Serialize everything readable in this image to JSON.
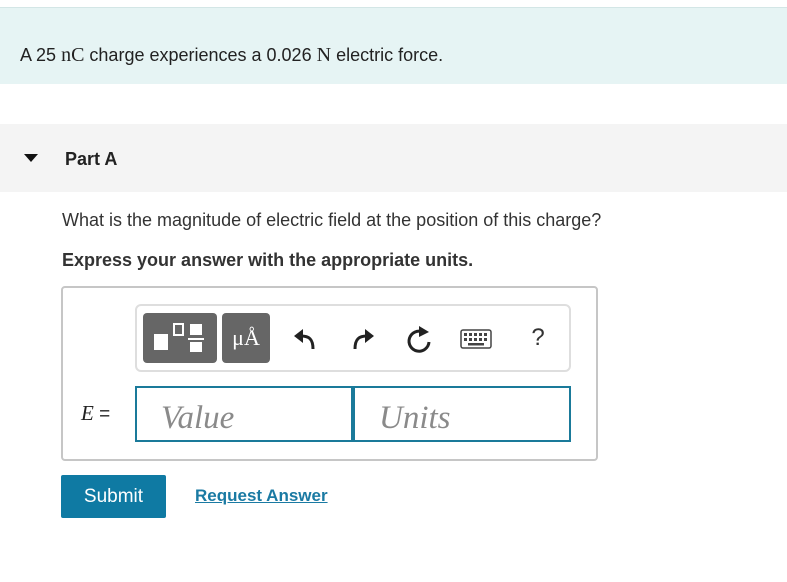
{
  "problem": {
    "text_1": "A 25",
    "charge_unit": "nC",
    "text_2": "charge experiences a 0.026",
    "force_unit": "N",
    "text_3": "electric force."
  },
  "part": {
    "title": "Part A",
    "question": "What is the magnitude of electric field at the position of this charge?",
    "instruction": "Express your answer with the appropriate units."
  },
  "toolbar": {
    "units_label": "μÅ",
    "help_label": "?",
    "icons": [
      "templates-icon",
      "units-icon",
      "undo-icon",
      "redo-icon",
      "reset-icon",
      "keyboard-icon",
      "help-icon"
    ]
  },
  "answer": {
    "variable": "E",
    "equals": "=",
    "value_placeholder": "Value",
    "units_placeholder": "Units"
  },
  "actions": {
    "submit_label": "Submit",
    "request_label": "Request Answer"
  },
  "colors": {
    "problem_bg": "#e6f4f4",
    "accent": "#0f7aa3",
    "field_border": "#1a7a9a"
  }
}
